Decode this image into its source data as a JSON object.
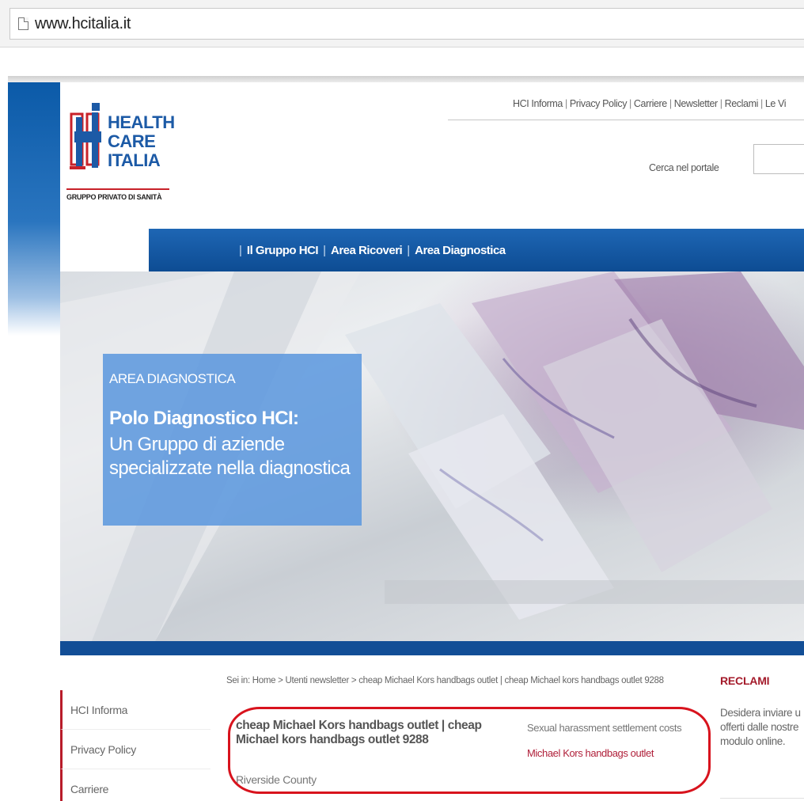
{
  "browser": {
    "url": "www.hcitalia.it",
    "page_icon": "page-icon"
  },
  "logo": {
    "line1": "HEALTH",
    "line2": "CARE",
    "line3": "ITALIA",
    "tagline": "GRUPPO PRIVATO DI SANITÀ",
    "colors": {
      "blue": "#1c5aa6",
      "red": "#c8222a"
    }
  },
  "util_nav": {
    "items": [
      "HCI Informa",
      "Privacy Policy",
      "Carriere",
      "Newsletter",
      "Reclami",
      "Le Vi"
    ]
  },
  "search": {
    "label": "Cerca nel portale",
    "value": ""
  },
  "main_nav": {
    "items": [
      "Il Gruppo HCI",
      "Area Ricoveri",
      "Area Diagnostica"
    ]
  },
  "hero": {
    "kicker": "AREA DIAGNOSTICA",
    "title": "Polo Diagnostico HCI:",
    "subtitle_line1": "Un Gruppo di aziende",
    "subtitle_line2": "specializzate nella diagnostica"
  },
  "sidebar": {
    "items": [
      "HCI Informa",
      "Privacy Policy",
      "Carriere"
    ]
  },
  "content": {
    "breadcrumb": "Sei in: Home > Utenti newsletter > cheap Michael Kors handbags outlet | cheap Michael kors handbags outlet 9288",
    "title": "cheap Michael Kors handbags outlet | cheap Michael kors handbags outlet 9288",
    "meta": "Riverside County",
    "related_text": "Sexual harassment settlement costs",
    "related_link": "Michael Kors handbags outlet"
  },
  "reclami": {
    "title": "RECLAMI",
    "line1": "Desidera inviare u",
    "line2": "offerti dalle nostre",
    "line3": "modulo online."
  },
  "colors": {
    "nav_blue": "#124e96",
    "accent_red": "#b81c2a",
    "highlight_red": "#d8131d",
    "hero_panel_blue": "#5d99de"
  }
}
